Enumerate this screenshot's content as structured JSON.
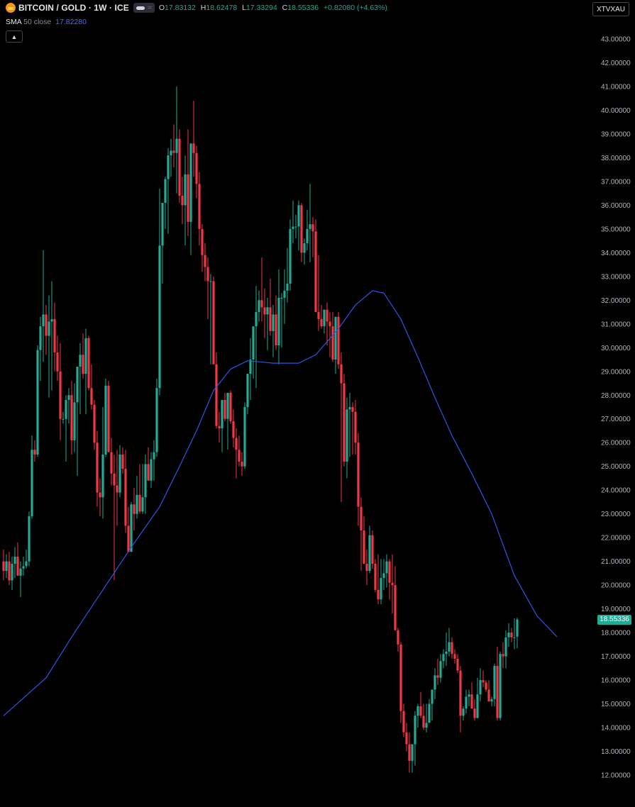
{
  "header": {
    "symbol": "BITCOIN / GOLD · 1W · ICE",
    "o_label": "O",
    "o_value": "17.83132",
    "h_label": "H",
    "h_value": "18.62478",
    "l_label": "L",
    "l_value": "17.33294",
    "c_label": "C",
    "c_value": "18.55336",
    "change": "+0.82080 (+4.63%)"
  },
  "indicator": {
    "name": "SMA",
    "params": "50 close",
    "value": "17.82280"
  },
  "ticker": "XTVXAU",
  "last_price": "18.55336",
  "colors": {
    "up": "#22ab94",
    "down": "#f23645",
    "sma": "#2f55e0",
    "background": "#000000"
  },
  "icons": [
    "bitcoin-gold-logo-icon",
    "eye-icon",
    "wave-icon",
    "chevron-up-icon"
  ],
  "chart_data": {
    "type": "candlestick",
    "ylim": [
      12.0,
      43.0
    ],
    "y_ticks": [
      "12.00000",
      "13.00000",
      "14.00000",
      "15.00000",
      "16.00000",
      "17.00000",
      "18.00000",
      "19.00000",
      "20.00000",
      "21.00000",
      "22.00000",
      "23.00000",
      "24.00000",
      "25.00000",
      "26.00000",
      "27.00000",
      "28.00000",
      "29.00000",
      "30.00000",
      "31.00000",
      "32.00000",
      "33.00000",
      "34.00000",
      "35.00000",
      "36.00000",
      "37.00000",
      "38.00000",
      "39.00000",
      "40.00000",
      "41.00000",
      "42.00000",
      "43.00000"
    ],
    "candles": [
      [
        21.0,
        21.5,
        20.2,
        20.6
      ],
      [
        20.6,
        21.3,
        20.3,
        21.0
      ],
      [
        21.0,
        21.4,
        20.0,
        20.2
      ],
      [
        20.2,
        21.2,
        19.8,
        20.9
      ],
      [
        20.9,
        21.6,
        20.3,
        21.2
      ],
      [
        21.2,
        21.8,
        20.4,
        20.4
      ],
      [
        20.4,
        21.0,
        19.5,
        20.7
      ],
      [
        20.7,
        21.2,
        20.4,
        20.8
      ],
      [
        20.8,
        21.5,
        20.7,
        21.0
      ],
      [
        21.0,
        23.1,
        20.8,
        22.9
      ],
      [
        22.9,
        26.3,
        22.8,
        25.7
      ],
      [
        25.7,
        26.1,
        25.2,
        25.5
      ],
      [
        25.5,
        30.1,
        25.4,
        29.9
      ],
      [
        29.9,
        31.3,
        28.6,
        30.9
      ],
      [
        30.9,
        34.1,
        29.4,
        31.4
      ],
      [
        31.4,
        31.8,
        29.7,
        30.5
      ],
      [
        30.5,
        32.2,
        27.9,
        31.1
      ],
      [
        31.1,
        32.8,
        28.2,
        31.2
      ],
      [
        31.2,
        31.9,
        29.0,
        29.8
      ],
      [
        29.8,
        30.5,
        28.6,
        29.0
      ],
      [
        29.0,
        30.2,
        26.1,
        27.0
      ],
      [
        27.0,
        27.3,
        26.8,
        27.0
      ],
      [
        27.0,
        28.0,
        25.2,
        27.8
      ],
      [
        27.8,
        28.3,
        26.8,
        28.0
      ],
      [
        28.0,
        28.6,
        25.5,
        26.1
      ],
      [
        26.1,
        28.5,
        25.6,
        27.7
      ],
      [
        27.7,
        29.0,
        24.6,
        29.2
      ],
      [
        29.2,
        30.2,
        27.2,
        29.7
      ],
      [
        29.7,
        30.6,
        28.7,
        28.9
      ],
      [
        28.9,
        30.8,
        27.2,
        30.4
      ],
      [
        30.4,
        30.5,
        28.2,
        28.3
      ],
      [
        28.3,
        29.3,
        27.4,
        27.6
      ],
      [
        27.6,
        27.8,
        25.7,
        26.0
      ],
      [
        26.0,
        26.5,
        23.3,
        23.9
      ],
      [
        23.9,
        24.5,
        22.9,
        23.7
      ],
      [
        23.7,
        27.5,
        22.8,
        25.5
      ],
      [
        25.5,
        28.7,
        25.4,
        28.4
      ],
      [
        28.4,
        28.6,
        25.6,
        25.6
      ],
      [
        25.6,
        26.2,
        24.2,
        24.7
      ],
      [
        24.7,
        25.5,
        20.2,
        24.2
      ],
      [
        24.2,
        25.7,
        22.5,
        23.9
      ],
      [
        23.9,
        25.9,
        23.7,
        25.5
      ],
      [
        25.5,
        25.8,
        24.7,
        24.9
      ],
      [
        24.9,
        25.7,
        22.2,
        22.5
      ],
      [
        22.5,
        23.3,
        21.4,
        21.4
      ],
      [
        21.4,
        23.5,
        21.5,
        23.4
      ],
      [
        23.4,
        24.1,
        22.3,
        23.0
      ],
      [
        23.0,
        24.6,
        22.8,
        23.8
      ],
      [
        23.8,
        25.1,
        23.0,
        23.1
      ],
      [
        23.1,
        25.1,
        23.0,
        23.7
      ],
      [
        23.7,
        25.5,
        23.0,
        25.1
      ],
      [
        25.1,
        25.8,
        24.5,
        24.4
      ],
      [
        24.4,
        25.6,
        24.1,
        25.3
      ],
      [
        25.3,
        26.1,
        24.4,
        25.6
      ],
      [
        25.6,
        28.7,
        25.4,
        28.3
      ],
      [
        28.3,
        36.7,
        28.0,
        34.3
      ],
      [
        34.3,
        36.1,
        32.7,
        36.1
      ],
      [
        36.1,
        37.2,
        35.0,
        37.1
      ],
      [
        37.1,
        38.4,
        34.8,
        38.1
      ],
      [
        38.1,
        38.8,
        37.2,
        38.3
      ],
      [
        38.3,
        39.4,
        37.6,
        38.2
      ],
      [
        38.2,
        41.0,
        36.5,
        38.8
      ],
      [
        38.8,
        39.2,
        36.1,
        36.4
      ],
      [
        36.4,
        37.2,
        35.2,
        36.0
      ],
      [
        36.0,
        38.1,
        34.3,
        37.3
      ],
      [
        37.3,
        39.2,
        34.7,
        35.3
      ],
      [
        35.3,
        38.6,
        33.9,
        38.6
      ],
      [
        38.6,
        40.4,
        37.2,
        38.2
      ],
      [
        38.2,
        38.5,
        36.3,
        36.9
      ],
      [
        36.9,
        37.4,
        34.3,
        35.0
      ],
      [
        35.0,
        35.2,
        33.2,
        33.9
      ],
      [
        33.9,
        34.4,
        32.8,
        33.4
      ],
      [
        33.4,
        33.8,
        31.2,
        32.8
      ],
      [
        32.8,
        33.1,
        29.3,
        32.8
      ],
      [
        32.8,
        33.0,
        29.3,
        29.3
      ],
      [
        29.3,
        29.8,
        26.6,
        26.7
      ],
      [
        26.7,
        27.3,
        26.0,
        26.6
      ],
      [
        26.6,
        27.8,
        25.6,
        27.8
      ],
      [
        27.8,
        28.1,
        26.9,
        27.0
      ],
      [
        27.0,
        28.0,
        25.7,
        28.1
      ],
      [
        28.1,
        28.2,
        26.8,
        26.9
      ],
      [
        26.9,
        27.4,
        25.8,
        26.2
      ],
      [
        26.2,
        26.6,
        24.5,
        25.7
      ],
      [
        25.7,
        26.3,
        25.0,
        25.2
      ],
      [
        25.2,
        25.6,
        24.6,
        25.0
      ],
      [
        25.0,
        27.7,
        24.9,
        27.5
      ],
      [
        27.5,
        28.6,
        27.2,
        28.9
      ],
      [
        28.9,
        30.4,
        27.8,
        29.5
      ],
      [
        29.5,
        30.9,
        28.7,
        30.9
      ],
      [
        30.9,
        32.6,
        28.3,
        31.5
      ],
      [
        31.5,
        32.4,
        31.1,
        32.0
      ],
      [
        32.0,
        33.8,
        31.1,
        31.7
      ],
      [
        31.7,
        32.5,
        30.4,
        31.4
      ],
      [
        31.4,
        32.1,
        29.9,
        31.7
      ],
      [
        31.7,
        32.9,
        30.5,
        30.7
      ],
      [
        30.7,
        31.8,
        29.6,
        31.4
      ],
      [
        31.4,
        32.2,
        29.9,
        30.1
      ],
      [
        30.1,
        33.3,
        29.3,
        32.1
      ],
      [
        32.1,
        32.3,
        30.0,
        32.1
      ],
      [
        32.1,
        33.3,
        31.0,
        32.4
      ],
      [
        32.4,
        34.2,
        31.9,
        32.7
      ],
      [
        32.7,
        35.4,
        32.4,
        35.0
      ],
      [
        35.0,
        36.2,
        34.4,
        35.1
      ],
      [
        35.1,
        35.6,
        34.6,
        35.1
      ],
      [
        35.1,
        36.2,
        34.1,
        36.0
      ],
      [
        36.0,
        36.1,
        33.6,
        34.0
      ],
      [
        34.0,
        34.6,
        33.5,
        34.4
      ],
      [
        34.4,
        35.8,
        34.1,
        35.0
      ],
      [
        35.0,
        36.9,
        33.6,
        35.2
      ],
      [
        35.2,
        35.5,
        33.8,
        34.9
      ],
      [
        34.9,
        35.4,
        33.9,
        31.5
      ],
      [
        31.5,
        33.9,
        30.7,
        31.2
      ],
      [
        31.2,
        31.8,
        30.8,
        30.9
      ],
      [
        30.9,
        31.6,
        30.6,
        31.6
      ],
      [
        31.6,
        31.9,
        30.1,
        31.1
      ],
      [
        31.1,
        31.5,
        29.6,
        30.9
      ],
      [
        30.9,
        31.5,
        29.4,
        29.5
      ],
      [
        29.5,
        31.3,
        28.9,
        31.3
      ],
      [
        31.3,
        31.5,
        29.1,
        29.3
      ],
      [
        29.3,
        29.8,
        23.5,
        28.5
      ],
      [
        28.5,
        28.9,
        25.0,
        25.2
      ],
      [
        25.2,
        27.9,
        24.5,
        27.4
      ],
      [
        27.4,
        28.1,
        25.4,
        27.5
      ],
      [
        27.5,
        27.7,
        25.5,
        27.3
      ],
      [
        27.3,
        27.8,
        25.5,
        26.0
      ],
      [
        26.0,
        26.4,
        22.5,
        23.3
      ],
      [
        23.3,
        23.7,
        20.6,
        22.3
      ],
      [
        22.3,
        22.9,
        21.1,
        20.9
      ],
      [
        20.9,
        21.5,
        20.0,
        20.6
      ],
      [
        20.6,
        22.5,
        20.5,
        22.1
      ],
      [
        22.1,
        22.3,
        20.7,
        20.9
      ],
      [
        20.9,
        21.1,
        19.7,
        19.8
      ],
      [
        19.8,
        21.3,
        19.2,
        19.4
      ],
      [
        19.4,
        21.1,
        19.2,
        20.3
      ],
      [
        20.3,
        21.1,
        19.8,
        20.5
      ],
      [
        20.5,
        21.3,
        19.9,
        21.0
      ],
      [
        21.0,
        21.1,
        19.4,
        20.1
      ],
      [
        20.1,
        21.3,
        18.8,
        20.0
      ],
      [
        20.0,
        20.8,
        18.1,
        18.1
      ],
      [
        18.1,
        18.2,
        17.2,
        17.5
      ],
      [
        17.5,
        17.6,
        14.2,
        14.7
      ],
      [
        14.7,
        15.0,
        13.6,
        13.8
      ],
      [
        13.8,
        14.2,
        13.0,
        13.3
      ],
      [
        13.3,
        13.8,
        12.1,
        12.6
      ],
      [
        12.6,
        13.3,
        12.1,
        13.3
      ],
      [
        13.3,
        14.7,
        12.4,
        14.5
      ],
      [
        14.5,
        15.0,
        14.0,
        14.9
      ],
      [
        14.9,
        15.5,
        14.4,
        14.5
      ],
      [
        14.5,
        15.0,
        13.9,
        14.0
      ],
      [
        14.0,
        15.0,
        13.8,
        14.2
      ],
      [
        14.2,
        15.2,
        14.2,
        15.0
      ],
      [
        15.0,
        15.6,
        14.3,
        15.6
      ],
      [
        15.6,
        16.5,
        15.2,
        16.2
      ],
      [
        16.2,
        16.9,
        15.8,
        16.1
      ],
      [
        16.1,
        17.1,
        15.9,
        16.8
      ],
      [
        16.8,
        17.3,
        16.5,
        17.1
      ],
      [
        17.1,
        18.0,
        16.6,
        17.2
      ],
      [
        17.2,
        18.2,
        17.0,
        17.6
      ],
      [
        17.6,
        17.8,
        16.9,
        17.1
      ],
      [
        17.1,
        17.3,
        16.7,
        16.9
      ],
      [
        16.9,
        17.1,
        16.3,
        16.4
      ],
      [
        16.4,
        16.6,
        13.8,
        14.5
      ],
      [
        14.5,
        14.9,
        14.3,
        14.8
      ],
      [
        14.8,
        15.6,
        14.6,
        15.3
      ],
      [
        15.3,
        15.6,
        14.9,
        15.4
      ],
      [
        15.4,
        15.9,
        14.8,
        14.8
      ],
      [
        14.8,
        15.2,
        14.3,
        14.4
      ],
      [
        14.4,
        16.1,
        14.4,
        15.4
      ],
      [
        15.4,
        16.5,
        15.1,
        16.0
      ],
      [
        16.0,
        16.4,
        15.7,
        15.9
      ],
      [
        15.9,
        16.0,
        15.5,
        15.6
      ],
      [
        15.6,
        16.0,
        15.1,
        15.1
      ],
      [
        15.1,
        15.3,
        14.9,
        15.2
      ],
      [
        15.2,
        16.7,
        14.9,
        16.6
      ],
      [
        16.6,
        17.4,
        14.3,
        14.4
      ],
      [
        14.4,
        17.2,
        14.3,
        17.1
      ],
      [
        17.1,
        17.6,
        16.5,
        17.0
      ],
      [
        17.0,
        18.1,
        16.5,
        17.8
      ],
      [
        17.8,
        18.4,
        17.4,
        18.0
      ],
      [
        18.0,
        18.2,
        17.6,
        17.8
      ],
      [
        17.8,
        18.6,
        17.3,
        17.8
      ],
      [
        17.83132,
        18.62478,
        17.33294,
        18.55336
      ]
    ],
    "sma": [
      [
        0,
        14.5
      ],
      [
        15,
        16.1
      ],
      [
        25,
        18.0
      ],
      [
        35,
        19.8
      ],
      [
        45,
        21.6
      ],
      [
        55,
        23.3
      ],
      [
        62,
        25.0
      ],
      [
        68,
        26.5
      ],
      [
        74,
        28.2
      ],
      [
        80,
        29.1
      ],
      [
        86,
        29.45
      ],
      [
        95,
        29.35
      ],
      [
        104,
        29.35
      ],
      [
        110,
        29.7
      ],
      [
        118,
        30.8
      ],
      [
        124,
        31.8
      ],
      [
        130,
        32.4
      ],
      [
        134,
        32.3
      ],
      [
        140,
        31.2
      ],
      [
        146,
        29.6
      ],
      [
        152,
        27.9
      ],
      [
        158,
        26.3
      ],
      [
        165,
        24.7
      ],
      [
        172,
        23.0
      ],
      [
        180,
        20.4
      ],
      [
        188,
        18.7
      ],
      [
        195,
        17.8228
      ]
    ],
    "grid": false,
    "legend": "none"
  }
}
